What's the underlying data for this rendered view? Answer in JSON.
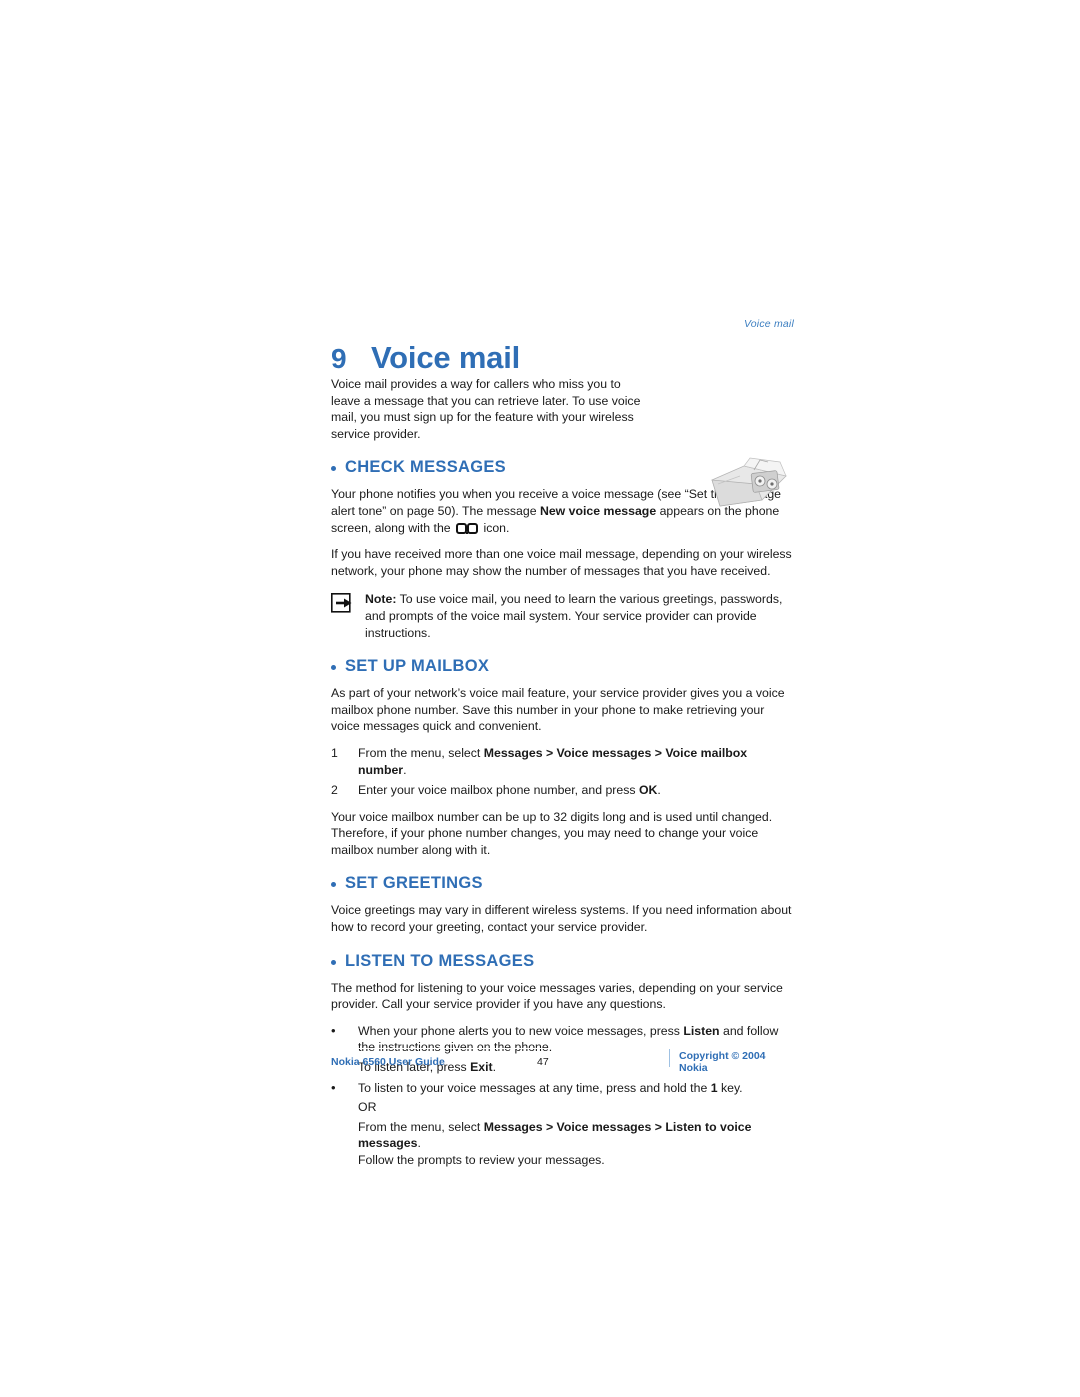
{
  "running_head": "Voice mail",
  "chapter": {
    "number": "9",
    "title": "Voice mail"
  },
  "intro": "Voice mail provides a way for callers who miss you to leave a message that you can retrieve later. To use voice mail, you must sign up for the feature with your wireless service provider.",
  "sections": {
    "check_messages": {
      "heading": "CHECK MESSAGES",
      "p1_part1": "Your phone notifies you when you receive a voice message (see “Set the message alert tone” on page 50). The message ",
      "p1_bold": "New voice message",
      "p1_part2": " appears on the phone screen, along with the ",
      "p1_part3": " icon.",
      "p2": "If you have received more than one voice mail message, depending on your wireless network, your phone may show the number of messages that you have received.",
      "note_label": "Note:",
      "note_text": " To use voice mail, you need to learn the various greetings, passwords, and prompts of the voice mail system. Your service provider can provide instructions."
    },
    "set_up_mailbox": {
      "heading": "SET UP MAILBOX",
      "p1": "As part of your network’s voice mail feature, your service provider gives you a voice mailbox phone number. Save this number in your phone to make retrieving your voice messages quick and convenient.",
      "steps": [
        {
          "num": "1",
          "pre": "From the menu, select ",
          "bold": "Messages > Voice messages > Voice mailbox number",
          "post": "."
        },
        {
          "num": "2",
          "pre": "Enter your voice mailbox phone number, and press ",
          "bold": "OK",
          "post": "."
        }
      ],
      "p2": "Your voice mailbox number can be up to 32 digits long and is used until changed. Therefore, if your phone number changes, you may need to change your voice mailbox number along with it."
    },
    "set_greetings": {
      "heading": "SET GREETINGS",
      "p1": "Voice greetings may vary in different wireless systems. If you need information about how to record your greeting, contact your service provider."
    },
    "listen_to_messages": {
      "heading": "LISTEN TO MESSAGES",
      "p1": "The method for listening to your voice messages varies, depending on your service provider. Call your service provider if you have any questions.",
      "bullets": [
        {
          "marker": "•",
          "pre": "When your phone alerts you to new voice messages, press ",
          "bold": "Listen",
          "post": " and follow the instructions given on the phone.",
          "sub_pre": "To listen later, press ",
          "sub_bold": "Exit",
          "sub_post": "."
        },
        {
          "marker": "•",
          "pre": "To listen to your voice messages at any time, press and hold the ",
          "bold": "1",
          "post": " key.",
          "sub_pre": "OR",
          "sub_bold": "",
          "sub_post": ""
        }
      ],
      "closing_pre": "From the menu, select ",
      "closing_bold": "Messages > Voice messages > Listen to voice messages",
      "closing_post": ".",
      "closing_line2": "Follow the prompts to review your messages."
    }
  },
  "footer": {
    "left": "Nokia 6560 User Guide",
    "page": "47",
    "right": "Copyright © 2004 Nokia"
  },
  "colors": {
    "accent": "#2f6eb5",
    "running_head": "#3d7fc1",
    "body": "#1a1a1a"
  }
}
